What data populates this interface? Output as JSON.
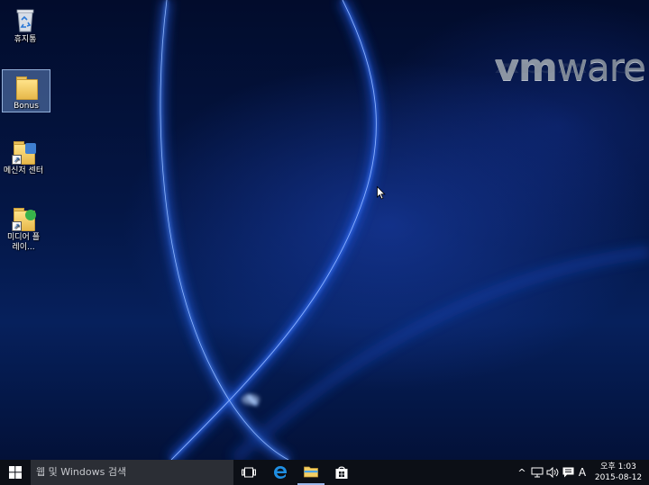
{
  "desktop": {
    "icons": [
      {
        "label": "휴지통"
      },
      {
        "label": "Bonus"
      },
      {
        "label": "메신저 센터"
      },
      {
        "label": "미디어 플레이..."
      }
    ],
    "logo": {
      "prefix": "vm",
      "suffix": "ware"
    }
  },
  "taskbar": {
    "search_placeholder": "웹 및 Windows 검색",
    "pinned": [
      "edge-icon",
      "file-explorer-icon",
      "store-icon"
    ],
    "tray": {
      "chevron": "^",
      "ime": "A"
    },
    "clock": {
      "time": "오후 1:03",
      "date": "2015-08-12"
    }
  },
  "colors": {
    "taskbar": "#0c0f16",
    "search_box": "#2b2e35",
    "desktop_blue": "#06205c",
    "edge_blue": "#1f8fe3",
    "folder_yellow": "#f3cf66"
  }
}
